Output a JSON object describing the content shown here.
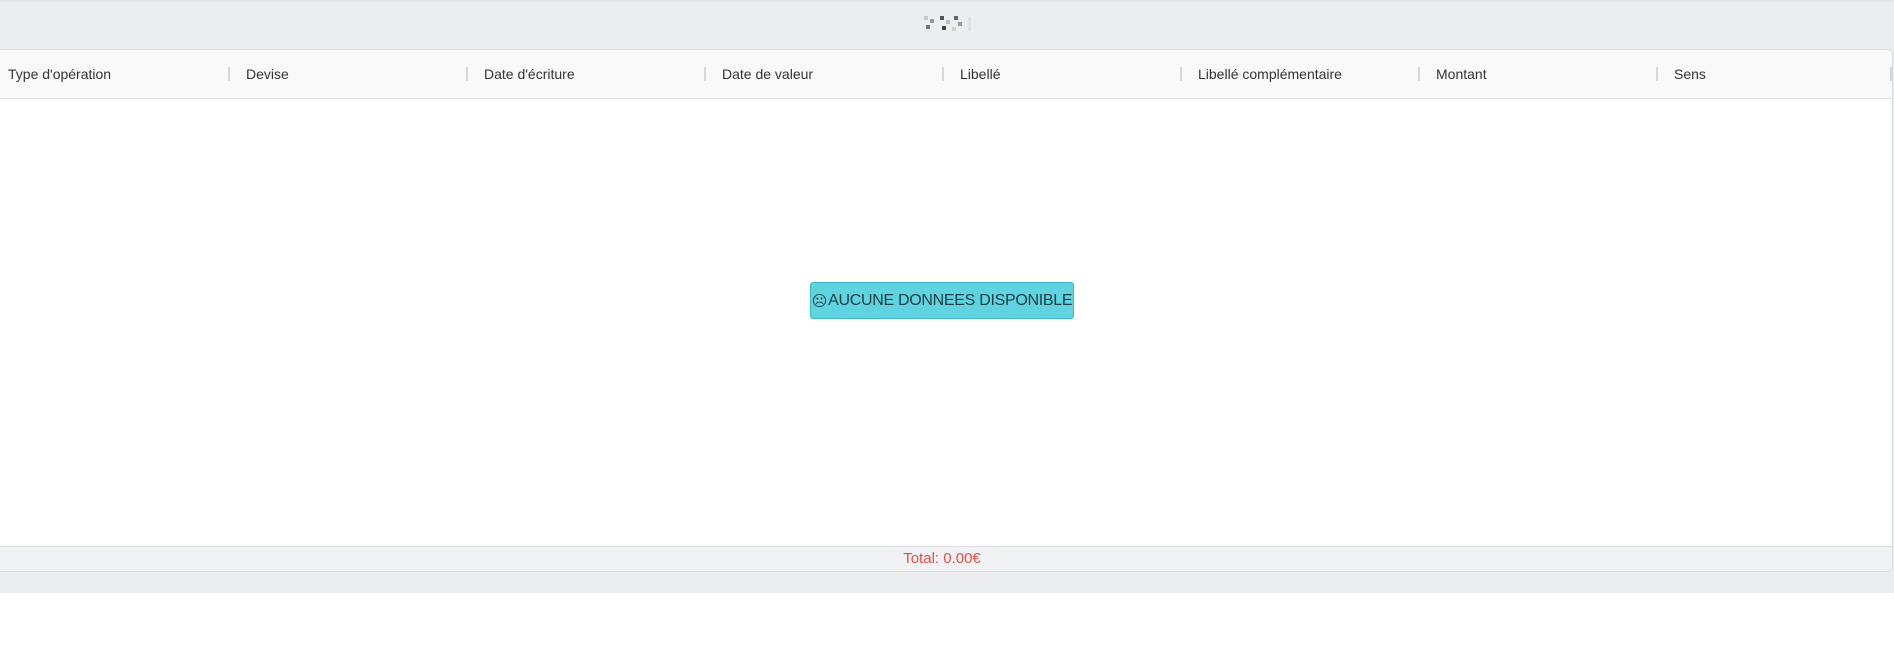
{
  "table": {
    "columns": [
      "Type d'opération",
      "Devise",
      "Date d'écriture",
      "Date de valeur",
      "Libellé",
      "Libellé complémentaire",
      "Montant",
      "Sens"
    ],
    "empty_message": "AUCUNE DONNEES DISPONIBLE",
    "empty_icon": "sad-face-icon",
    "total_label": "Total: 0.00€"
  },
  "colors": {
    "empty_badge_bg": "#5fd3e0",
    "total_text": "#e3504a"
  }
}
